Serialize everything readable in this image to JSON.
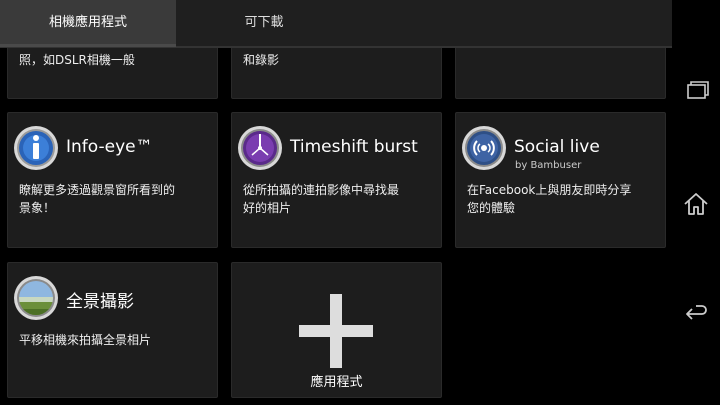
{
  "tabs": [
    {
      "label": "相機應用程式"
    },
    {
      "label": "可下載"
    }
  ],
  "partial_cards": [
    {
      "desc": "照，如DSLR相機一般"
    },
    {
      "desc": "和錄影"
    },
    {
      "desc": ""
    }
  ],
  "apps": [
    {
      "title": "Info-eye™",
      "subtitle": "",
      "desc1": "瞭解更多透過觀景窗所看到的",
      "desc2": "景象！",
      "icon": "info-eye-icon"
    },
    {
      "title": "Timeshift burst",
      "subtitle": "",
      "desc1": "從所拍攝的連拍影像中尋找最",
      "desc2": "好的相片",
      "icon": "timeshift-burst-icon"
    },
    {
      "title": "Social live",
      "subtitle": "by Bambuser",
      "desc1": "在Facebook上與朋友即時分享",
      "desc2": "您的體驗",
      "icon": "social-live-icon"
    },
    {
      "title": "全景攝影",
      "subtitle": "",
      "desc1": "平移相機來拍攝全景相片",
      "desc2": "",
      "icon": "panorama-icon"
    }
  ],
  "add_card": {
    "label": "應用程式"
  },
  "nav": {
    "recent": "recent-apps-icon",
    "home": "home-icon",
    "back": "back-icon"
  }
}
